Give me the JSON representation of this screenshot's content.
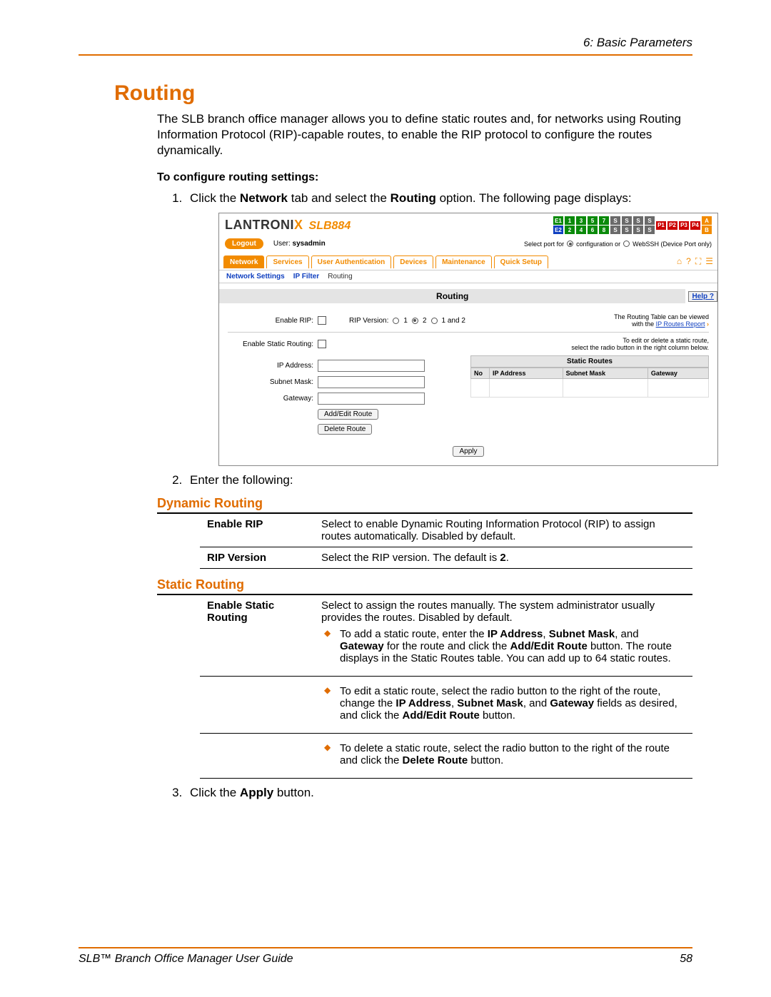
{
  "header": {
    "chapter": "6: Basic Parameters"
  },
  "title": "Routing",
  "intro": "The SLB branch office manager allows you to define static routes and, for networks using Routing Information Protocol (RIP)-capable routes, to enable the RIP protocol to configure the routes dynamically.",
  "subhead": "To configure routing settings:",
  "step1_pre": "Click the ",
  "step1_b1": "Network",
  "step1_mid": " tab and select the ",
  "step1_b2": "Routing",
  "step1_post": " option. The following page displays:",
  "step2": "Enter the following:",
  "step3_pre": "Click the ",
  "step3_b": "Apply",
  "step3_post": " button.",
  "screenshot": {
    "brand": "LANTRONI",
    "brand_x": "X",
    "model": "SLB884",
    "portcols_e": [
      "E1",
      "E2"
    ],
    "portcols_nums": [
      "1",
      "2",
      "3",
      "4",
      "5",
      "6",
      "7",
      "8"
    ],
    "portcols_s": "S",
    "portcols_p": [
      "P1",
      "P2",
      "P3",
      "P4"
    ],
    "portcols_ab": [
      "A",
      "B"
    ],
    "logout": "Logout",
    "user_lbl": "User: ",
    "user_val": "sysadmin",
    "selport_lbl": "Select port for",
    "selport_opt1": "configuration or",
    "selport_opt2": "WebSSH (Device Port only)",
    "tabs": [
      "Network",
      "Services",
      "User Authentication",
      "Devices",
      "Maintenance",
      "Quick Setup"
    ],
    "subtabs": [
      "Network Settings",
      "IP Filter",
      "Routing"
    ],
    "section_title": "Routing",
    "help": "Help ?",
    "enable_rip_lbl": "Enable RIP:",
    "rip_version_lbl": "RIP Version:",
    "rip_opts": [
      "1",
      "2",
      "1 and 2"
    ],
    "note1a": "The Routing Table can be viewed",
    "note1b": "with the ",
    "note1link": "IP Routes Report",
    "enable_static_lbl": "Enable Static Routing:",
    "note2a": "To edit or delete a static route,",
    "note2b": "select the radio button in the right column below.",
    "ip_lbl": "IP Address:",
    "mask_lbl": "Subnet Mask:",
    "gw_lbl": "Gateway:",
    "btn_addedit": "Add/Edit Route",
    "btn_delete": "Delete  Route",
    "btn_apply": "Apply",
    "static_routes_title": "Static Routes",
    "sr_cols": [
      "No",
      "IP Address",
      "Subnet Mask",
      "Gateway"
    ]
  },
  "dynamic_title": "Dynamic Routing",
  "dyn_row1_label": "Enable RIP",
  "dyn_row1_text": "Select to enable Dynamic Routing Information Protocol (RIP) to assign routes automatically. Disabled by default.",
  "dyn_row2_label": "RIP Version",
  "dyn_row2_pre": "Select the RIP version. The default is ",
  "dyn_row2_b": "2",
  "dyn_row2_post": ".",
  "static_title": "Static Routing",
  "stat_label": "Enable Static Routing",
  "stat_intro": "Select to assign the routes manually. The system administrator usually provides the routes. Disabled by default.",
  "stat_b1_a": "To add a static route, enter the ",
  "stat_b1_b": "IP Address",
  "stat_b1_c": ", ",
  "stat_b1_d": "Subnet Mask",
  "stat_b1_e": ", and ",
  "stat_b1_f": "Gateway",
  "stat_b1_g": " for the route and click the ",
  "stat_b1_h": "Add/Edit Route",
  "stat_b1_i": " button. The route displays in the Static Routes table. You can add up to 64 static routes.",
  "stat_b2_a": "To edit a static route, select the radio button to the right of the route, change the ",
  "stat_b2_b": "IP Address",
  "stat_b2_c": ", ",
  "stat_b2_d": "Subnet Mask",
  "stat_b2_e": ", and ",
  "stat_b2_f": "Gateway",
  "stat_b2_g": " fields as desired, and click the ",
  "stat_b2_h": "Add/Edit Route",
  "stat_b2_i": " button.",
  "stat_b3_a": "To delete a static route, select the radio button to the right of the route and click the ",
  "stat_b3_b": "Delete Route",
  "stat_b3_c": " button.",
  "footer": {
    "title": "SLB™ Branch Office Manager User Guide",
    "page": "58"
  }
}
